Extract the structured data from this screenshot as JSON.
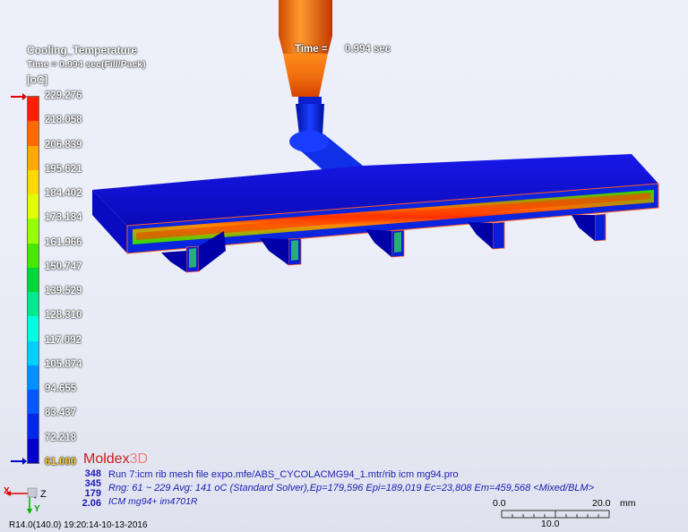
{
  "legend": {
    "title": "Cooling_Temperature",
    "time_line": "Time = 0.994 sec(Fill/Pack)",
    "unit": "[oC]",
    "ticks": [
      "229.276",
      "218.058",
      "206.839",
      "195.621",
      "184.402",
      "173.184",
      "161.966",
      "150.747",
      "139.529",
      "128.310",
      "117.092",
      "105.874",
      "94.655",
      "83.437",
      "72.218",
      "61.000"
    ],
    "colors": [
      "#ff1e00",
      "#ff6a00",
      "#ffa800",
      "#ffd800",
      "#e0ff00",
      "#96ff00",
      "#46e800",
      "#00d83a",
      "#00e890",
      "#00ffe0",
      "#00cfff",
      "#0090ff",
      "#0058ff",
      "#0028e8",
      "#0000c8"
    ]
  },
  "header": {
    "time_label": "Time =",
    "time_value": "0.994 sec"
  },
  "brand": {
    "moldex": "Moldex",
    "three_d": "3D"
  },
  "run_info": {
    "counts": [
      "348",
      "345",
      "179",
      "2.06"
    ],
    "line1": "Run 7:icm rib mesh file expo.mfe/ABS_CYCOLACMG94_1.mtr/rib icm mg94.pro",
    "line2": "Rng: 61 ~ 229   Avg: 141 oC (Standard Solver),Ep=179,596 Epi=189,019 Ec=23,808 Em=459,568  <Mixed/BLM>",
    "line3": "ICM mg94+ im4701R"
  },
  "scale_bar": {
    "start": "0.0",
    "end": "20.0",
    "unit": "mm",
    "mid": "10.0"
  },
  "triad": {
    "x": "X",
    "z": "Z",
    "y": "Y"
  },
  "footer": {
    "version": "R14.0(140.0) 19:20:14-10-13-2016"
  }
}
